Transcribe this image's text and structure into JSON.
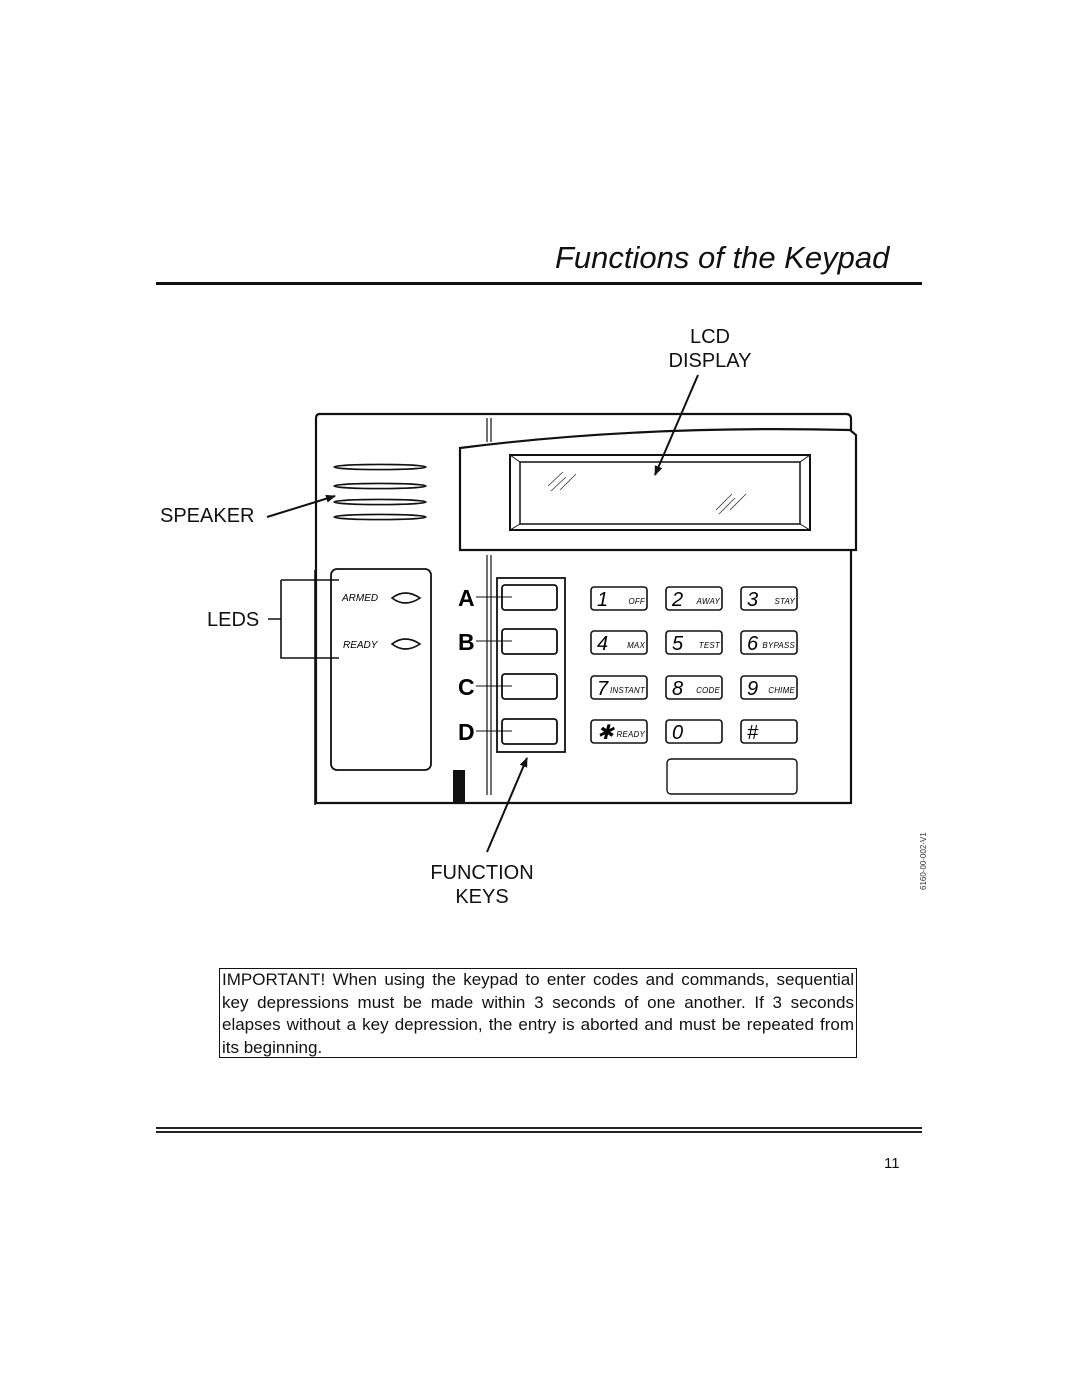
{
  "page": {
    "title": "Functions of the Keypad",
    "page_number": "11"
  },
  "figure": {
    "callouts": {
      "lcd_display": [
        "LCD",
        "DISPLAY"
      ],
      "speaker": "SPEAKER",
      "leds": "LEDS",
      "function_keys": [
        "FUNCTION",
        "KEYS"
      ]
    },
    "figure_code": "6160-00-002-V1",
    "leds": [
      {
        "label": "ARMED"
      },
      {
        "label": "READY"
      }
    ],
    "function_keys": [
      "A",
      "B",
      "C",
      "D"
    ],
    "keys": [
      {
        "num": "1",
        "sub": "OFF"
      },
      {
        "num": "2",
        "sub": "AWAY"
      },
      {
        "num": "3",
        "sub": "STAY"
      },
      {
        "num": "4",
        "sub": "MAX"
      },
      {
        "num": "5",
        "sub": "TEST"
      },
      {
        "num": "6",
        "sub": "BYPASS"
      },
      {
        "num": "7",
        "sub": "INSTANT"
      },
      {
        "num": "8",
        "sub": "CODE"
      },
      {
        "num": "9",
        "sub": "CHIME"
      },
      {
        "num": "✱",
        "sub": "READY"
      },
      {
        "num": "0",
        "sub": ""
      },
      {
        "num": "#",
        "sub": ""
      }
    ]
  },
  "important_note": "IMPORTANT! When using the keypad to enter codes and commands, sequential key depressions must be made within 3 seconds of one another. If 3 seconds elapses without a key depression, the entry is aborted and must be repeated from its beginning."
}
